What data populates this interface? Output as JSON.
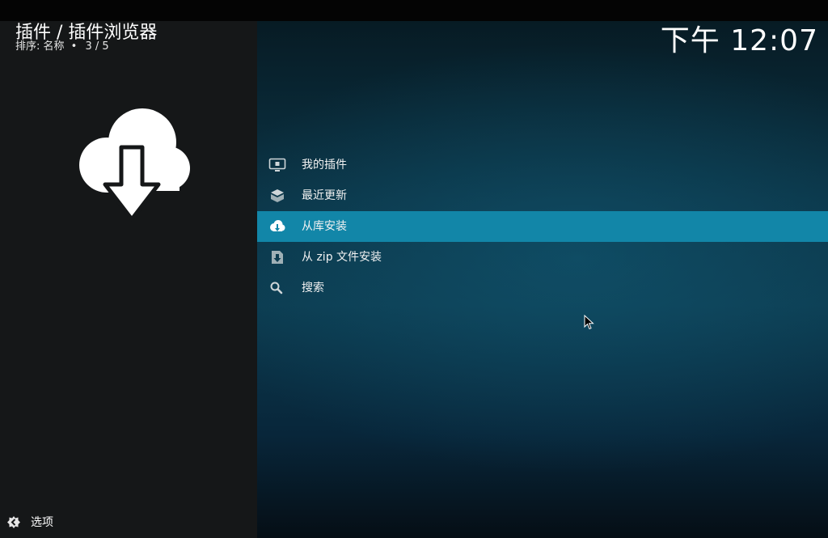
{
  "header": {
    "title": "插件 / 插件浏览器",
    "sort_label": "排序: 名称",
    "bullet": "•",
    "position": "3 / 5"
  },
  "clock": "下午 12:07",
  "menu": {
    "items": [
      {
        "label": "我的插件",
        "icon": "monitor-addon-icon",
        "selected": false
      },
      {
        "label": "最近更新",
        "icon": "open-box-icon",
        "selected": false
      },
      {
        "label": "从库安装",
        "icon": "cloud-download-icon",
        "selected": true
      },
      {
        "label": "从 zip 文件安装",
        "icon": "zip-install-icon",
        "selected": false
      },
      {
        "label": "搜索",
        "icon": "search-icon",
        "selected": false
      }
    ]
  },
  "footer": {
    "options_label": "选项",
    "options_icon": "options-gear-icon"
  },
  "colors": {
    "selected_row": "#1286a8",
    "left_panel": "#151718",
    "right_panel": "#0c3b4f"
  }
}
